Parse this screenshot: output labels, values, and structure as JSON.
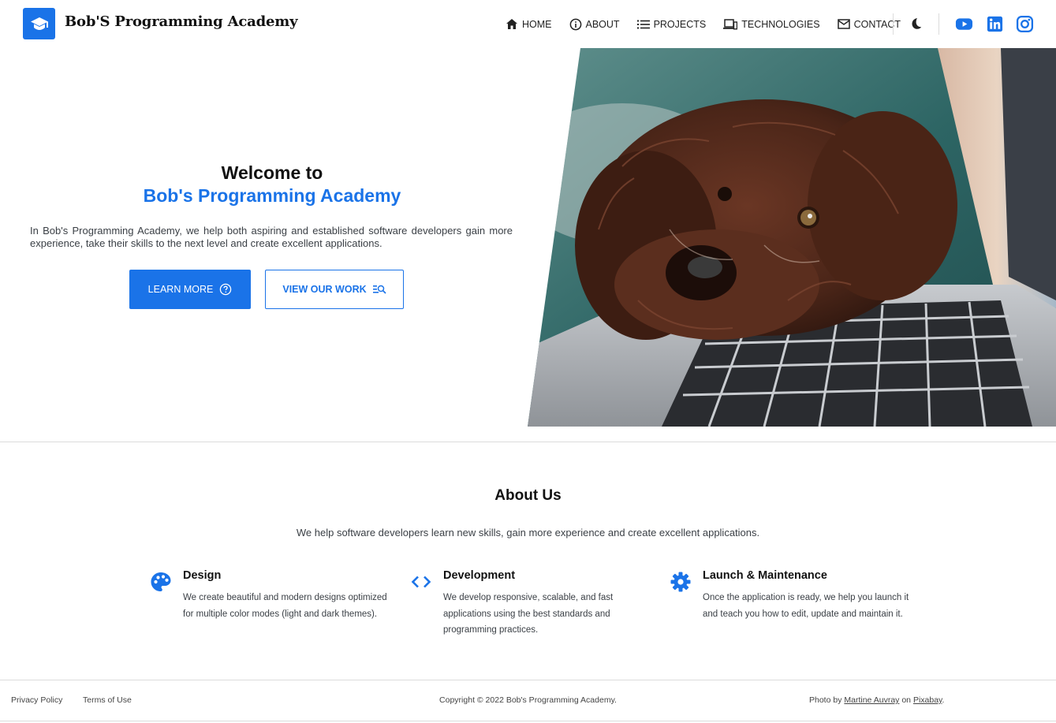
{
  "header": {
    "brand": "Bob'S Programming Academy",
    "logo_icon": "graduation-cap-icon",
    "nav": [
      {
        "label": "HOME",
        "icon": "home-icon"
      },
      {
        "label": "ABOUT",
        "icon": "info-icon"
      },
      {
        "label": "PROJECTS",
        "icon": "list-icon"
      },
      {
        "label": "TECHNOLOGIES",
        "icon": "devices-icon"
      },
      {
        "label": "CONTACT",
        "icon": "mail-icon"
      }
    ],
    "theme_toggle_icon": "moon-icon",
    "social": [
      "youtube-icon",
      "linkedin-icon",
      "instagram-icon"
    ]
  },
  "hero": {
    "title_line1": "Welcome to",
    "title_line2": "Bob's Programming Academy",
    "description": "In Bob's Programming Academy, we help both aspiring and established software developers gain more experience, take their skills to the next level and create excellent applications.",
    "primary_button": "LEARN MORE",
    "secondary_button": "VIEW OUR WORK",
    "photo_alt": "Dog resting its head on a laptop keyboard"
  },
  "about": {
    "title": "About Us",
    "subtitle": "We help software developers learn new skills, gain more experience and create excellent applications.",
    "features": [
      {
        "title": "Design",
        "text": "We create beautiful and modern designs optimized for multiple color modes (light and dark themes).",
        "icon": "palette-icon"
      },
      {
        "title": "Development",
        "text": "We develop responsive, scalable, and fast applications using the best standards and programming practices.",
        "icon": "code-icon"
      },
      {
        "title": "Launch & Maintenance",
        "text": "Once the application is ready, we help you launch it and teach you how to edit, update and maintain it.",
        "icon": "gear-icon"
      }
    ]
  },
  "footer": {
    "privacy": "Privacy Policy",
    "terms": "Terms of Use",
    "copyright": "Copyright © 2022 Bob's Programming Academy.",
    "credit_prefix": "Photo by",
    "credit_author": "Martine Auvray",
    "credit_on": "on",
    "credit_site": "Pixabay",
    "credit_suffix": "."
  },
  "colors": {
    "accent": "#1a73e8",
    "text": "#212529",
    "muted": "#3a3f45"
  }
}
